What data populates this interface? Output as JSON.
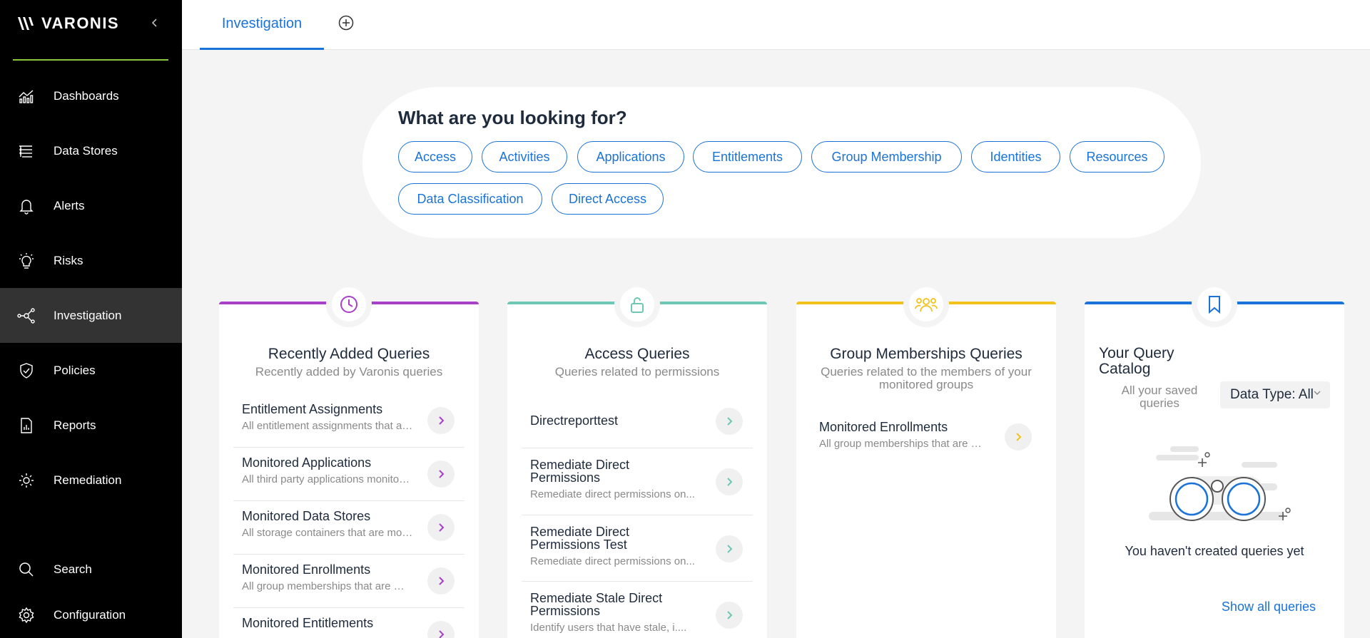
{
  "brand": {
    "name": "VARONIS"
  },
  "sidebar": {
    "items": [
      {
        "label": "Dashboards",
        "icon": "chart-icon"
      },
      {
        "label": "Data Stores",
        "icon": "data-stores-icon"
      },
      {
        "label": "Alerts",
        "icon": "bell-icon"
      },
      {
        "label": "Risks",
        "icon": "lightbulb-icon"
      },
      {
        "label": "Investigation",
        "icon": "graph-nodes-icon",
        "active": true
      },
      {
        "label": "Policies",
        "icon": "shield-check-icon"
      },
      {
        "label": "Reports",
        "icon": "report-icon"
      },
      {
        "label": "Remediation",
        "icon": "sun-icon"
      },
      {
        "label": "Search",
        "icon": "search-icon"
      },
      {
        "label": "Configuration",
        "icon": "gear-icon"
      }
    ]
  },
  "tabs": [
    {
      "label": "Investigation",
      "active": true
    }
  ],
  "search": {
    "title": "What are you looking for?",
    "chips": [
      "Access",
      "Activities",
      "Applications",
      "Entitlements",
      "Group Membership",
      "Identities",
      "Resources",
      "Data Classification",
      "Direct Access"
    ]
  },
  "cards": [
    {
      "title": "Recently Added Queries",
      "subtitle": "Recently added by Varonis queries",
      "color": "#a73fc8",
      "icon": "clock-icon",
      "items": [
        {
          "title": "Entitlement Assignments",
          "desc": "All entitlement assignments that are..."
        },
        {
          "title": "Monitored Applications",
          "desc": "All third party applications monitored..."
        },
        {
          "title": "Monitored Data Stores",
          "desc": "All storage containers that are monitored..."
        },
        {
          "title": "Monitored Enrollments",
          "desc": "All group memberships that are monitored..."
        },
        {
          "title": "Monitored Entitlements",
          "desc": ""
        }
      ]
    },
    {
      "title": "Access Queries",
      "subtitle": "Queries related to permissions",
      "color": "#6cc8b4",
      "icon": "unlock-icon",
      "items": [
        {
          "title": "Directreporttest",
          "desc": ""
        },
        {
          "title": "Remediate Direct Permissions",
          "desc": "Remediate direct permissions on..."
        },
        {
          "title": "Remediate Direct Permissions Test",
          "desc": "Remediate direct permissions on..."
        },
        {
          "title": "Remediate Stale Direct Permissions",
          "desc": "Identify users that have stale, i...."
        }
      ]
    },
    {
      "title": "Group Memberships Queries",
      "subtitle": "Queries related to the members of your monitored groups",
      "color": "#f2c21b",
      "icon": "users-icon",
      "items": [
        {
          "title": "Monitored Enrollments",
          "desc": "All group memberships that are monitored..."
        }
      ]
    },
    {
      "title": "Your Query Catalog",
      "subtitle": "All your saved queries",
      "color": "#1a73d8",
      "icon": "bookmark-icon",
      "data_type": "Data Type: All",
      "empty_text": "You haven't created queries yet",
      "show_all": "Show all queries"
    }
  ]
}
